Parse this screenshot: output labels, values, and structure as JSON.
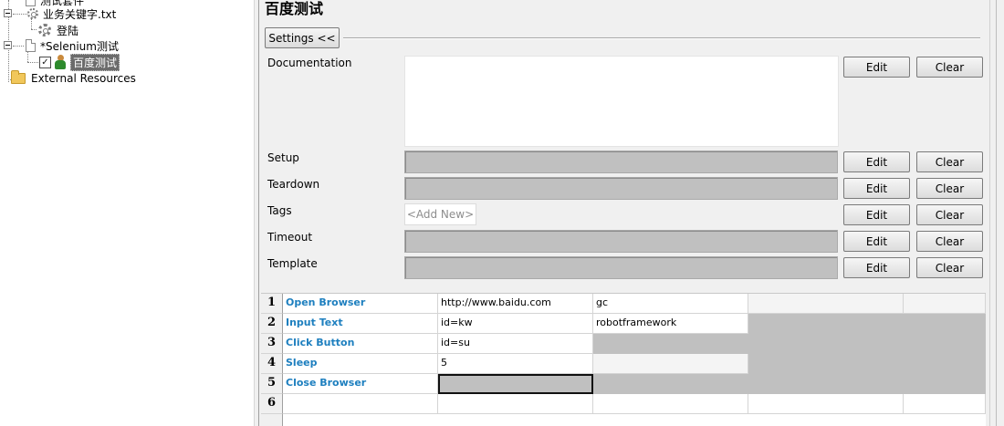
{
  "tree": {
    "items": [
      {
        "label": "测试套件"
      },
      {
        "label": "业务关键字.txt"
      },
      {
        "label": "登陆"
      },
      {
        "label": "*Selenium测试"
      },
      {
        "label": "百度测试",
        "checked": true,
        "check_glyph": "✓"
      },
      {
        "label": "External Resources"
      }
    ]
  },
  "editor": {
    "title": "百度测试",
    "settings_label": "Settings <<",
    "fields": [
      {
        "label": "Documentation"
      },
      {
        "label": "Setup"
      },
      {
        "label": "Teardown"
      },
      {
        "label": "Tags"
      },
      {
        "label": "Timeout"
      },
      {
        "label": "Template"
      }
    ],
    "tags_placeholder": "<Add New>",
    "edit_label": "Edit",
    "clear_label": "Clear"
  },
  "grid": {
    "rows": [
      {
        "num": "1",
        "cells": [
          "Open Browser",
          "http://www.baidu.com",
          "gc",
          "",
          ""
        ]
      },
      {
        "num": "2",
        "cells": [
          "Input Text",
          "id=kw",
          "robotframework",
          "",
          ""
        ]
      },
      {
        "num": "3",
        "cells": [
          "Click Button",
          "id=su",
          "",
          "",
          ""
        ]
      },
      {
        "num": "4",
        "cells": [
          "Sleep",
          "5",
          "",
          "",
          ""
        ]
      },
      {
        "num": "5",
        "cells": [
          "Close Browser",
          "",
          "",
          "",
          ""
        ]
      },
      {
        "num": "6",
        "cells": [
          "",
          "",
          "",
          "",
          ""
        ]
      }
    ]
  }
}
